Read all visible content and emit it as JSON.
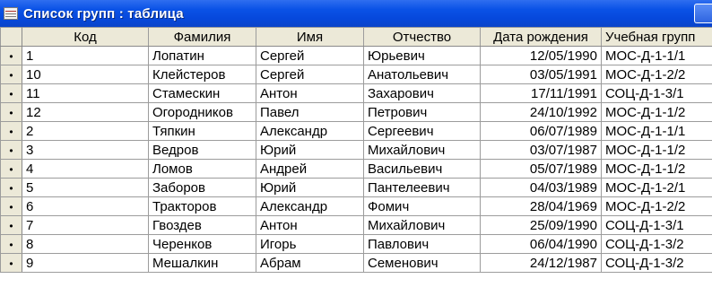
{
  "window": {
    "title": "Список групп : таблица"
  },
  "columns": [
    "Код",
    "Фамилия",
    "Имя",
    "Отчество",
    "Дата рождения",
    "Учебная групп"
  ],
  "row_marker": "•",
  "rows": [
    {
      "code": "1",
      "last": "Лопатин",
      "first": "Сергей",
      "middle": "Юрьевич",
      "dob": "12/05/1990",
      "group": "МОС-Д-1-1/1"
    },
    {
      "code": "10",
      "last": "Клейстеров",
      "first": "Сергей",
      "middle": "Анатольевич",
      "dob": "03/05/1991",
      "group": "МОС-Д-1-2/2"
    },
    {
      "code": "11",
      "last": "Стамескин",
      "first": "Антон",
      "middle": "Захарович",
      "dob": "17/11/1991",
      "group": "СОЦ-Д-1-3/1"
    },
    {
      "code": "12",
      "last": "Огородников",
      "first": "Павел",
      "middle": "Петрович",
      "dob": "24/10/1992",
      "group": "МОС-Д-1-1/2"
    },
    {
      "code": "2",
      "last": "Тяпкин",
      "first": "Александр",
      "middle": "Сергеевич",
      "dob": "06/07/1989",
      "group": "МОС-Д-1-1/1"
    },
    {
      "code": "3",
      "last": "Ведров",
      "first": "Юрий",
      "middle": "Михайлович",
      "dob": "03/07/1987",
      "group": "МОС-Д-1-1/2"
    },
    {
      "code": "4",
      "last": "Ломов",
      "first": "Андрей",
      "middle": "Васильевич",
      "dob": "05/07/1989",
      "group": "МОС-Д-1-1/2"
    },
    {
      "code": "5",
      "last": "Заборов",
      "first": "Юрий",
      "middle": "Пантелеевич",
      "dob": "04/03/1989",
      "group": "МОС-Д-1-2/1"
    },
    {
      "code": "6",
      "last": "Тракторов",
      "first": "Александр",
      "middle": "Фомич",
      "dob": "28/04/1969",
      "group": "МОС-Д-1-2/2"
    },
    {
      "code": "7",
      "last": "Гвоздев",
      "first": "Антон",
      "middle": "Михайлович",
      "dob": "25/09/1990",
      "group": "СОЦ-Д-1-3/1"
    },
    {
      "code": "8",
      "last": "Черенков",
      "first": "Игорь",
      "middle": "Павлович",
      "dob": "06/04/1990",
      "group": "СОЦ-Д-1-3/2"
    },
    {
      "code": "9",
      "last": "Мешалкин",
      "first": "Абрам",
      "middle": "Семенович",
      "dob": "24/12/1987",
      "group": "СОЦ-Д-1-3/2"
    }
  ]
}
